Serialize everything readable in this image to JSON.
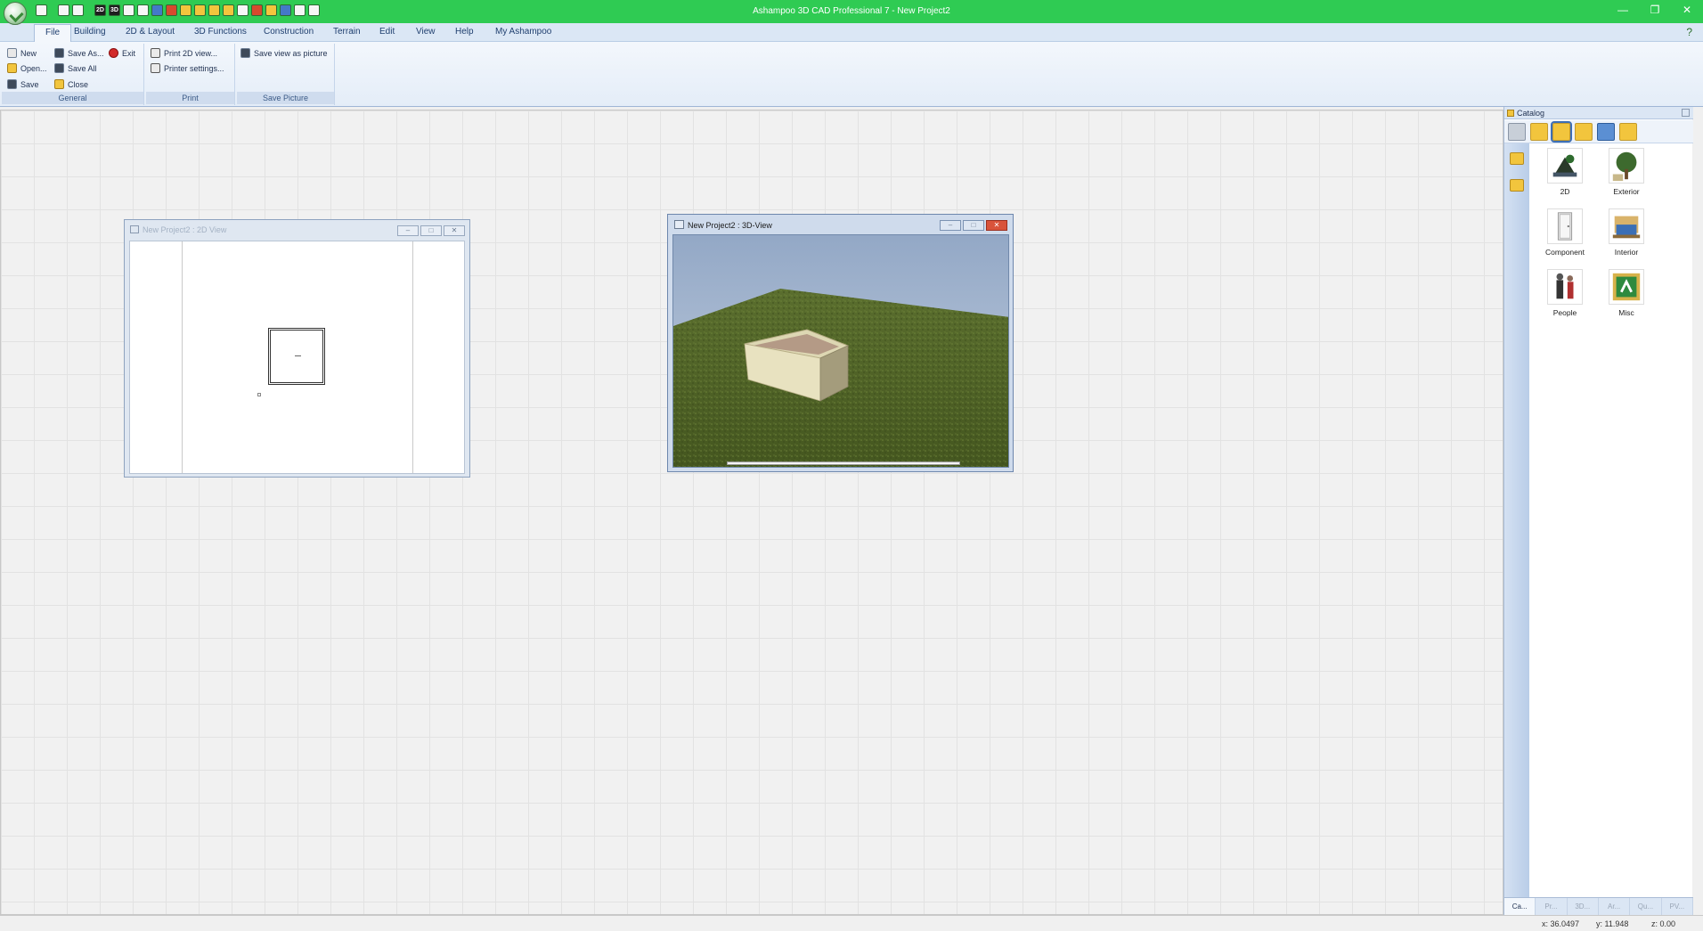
{
  "window": {
    "title": "Ashampoo 3D CAD Professional 7 - New Project2",
    "controls": {
      "minimize": "—",
      "restore": "❐",
      "close": "✕"
    }
  },
  "ribbon": {
    "tabs": [
      {
        "label": "File",
        "active": true
      },
      {
        "label": "Building"
      },
      {
        "label": "2D & Layout"
      },
      {
        "label": "3D Functions"
      },
      {
        "label": "Construction"
      },
      {
        "label": "Terrain"
      },
      {
        "label": "Edit"
      },
      {
        "label": "View"
      },
      {
        "label": "Help"
      },
      {
        "label": "My Ashampoo"
      }
    ],
    "groups": {
      "general": {
        "label": "General",
        "new": "New",
        "open": "Open...",
        "save": "Save",
        "save_as": "Save As...",
        "save_all": "Save All",
        "close": "Close",
        "exit": "Exit"
      },
      "print": {
        "label": "Print",
        "print_2d": "Print 2D view...",
        "printer_settings": "Printer settings..."
      },
      "save_picture": {
        "label": "Save Picture",
        "save_view": "Save view as picture"
      }
    }
  },
  "windows": {
    "view2d": {
      "title": "New Project2 : 2D View"
    },
    "view3d": {
      "title": "New Project2 : 3D-View"
    }
  },
  "catalog": {
    "title": "Catalog",
    "items": [
      {
        "label": "2D",
        "icon": "2d-catalog-icon"
      },
      {
        "label": "Exterior",
        "icon": "exterior-catalog-icon"
      },
      {
        "label": "Component",
        "icon": "component-catalog-icon"
      },
      {
        "label": "Interior",
        "icon": "interior-catalog-icon"
      },
      {
        "label": "People",
        "icon": "people-catalog-icon"
      },
      {
        "label": "Misc",
        "icon": "misc-catalog-icon"
      }
    ],
    "bottom_tabs": [
      "Ca...",
      "Pr...",
      "3D...",
      "Ar...",
      "Qu...",
      "PV..."
    ]
  },
  "status": {
    "x": "x: 36.0497",
    "y": "y: 11.948",
    "z": "z: 0.00"
  },
  "colors": {
    "titlebar": "#2fcb53",
    "ribbon_tab_bg": "#dbe7f5",
    "grass": "#4f6428",
    "sky": "#a9bbd4"
  }
}
